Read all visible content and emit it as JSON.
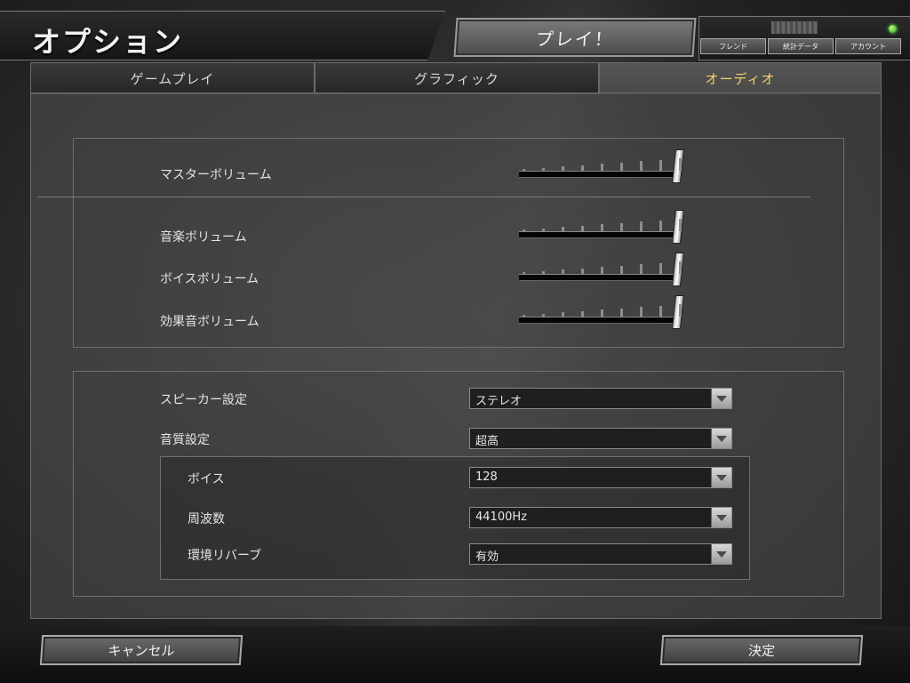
{
  "header": {
    "title": "オプション",
    "play_label": "プレイ！",
    "buttons": [
      "フレンド",
      "統計データ",
      "アカウント"
    ]
  },
  "tabs": [
    {
      "label": "ゲームプレイ",
      "active": false
    },
    {
      "label": "グラフィック",
      "active": false
    },
    {
      "label": "オーディオ",
      "active": true
    }
  ],
  "volume": {
    "master_label": "マスターボリューム",
    "music_label": "音楽ボリューム",
    "voice_label": "ボイスボリューム",
    "effects_label": "効果音ボリューム",
    "master_level": 1.0,
    "music_level": 1.0,
    "voice_level": 1.0,
    "effects_level": 1.0
  },
  "settings": {
    "speaker_label": "スピーカー設定",
    "speaker_value": "ステレオ",
    "quality_label": "音質設定",
    "quality_value": "超高",
    "voices_label": "ボイス",
    "voices_value": "128",
    "frequency_label": "周波数",
    "frequency_value": "44100Hz",
    "reverb_label": "環境リバーブ",
    "reverb_value": "有効"
  },
  "footer": {
    "cancel_label": "キャンセル",
    "ok_label": "決定"
  },
  "colors": {
    "active_tab_text": "#f5d36a",
    "status_online": "#2e9a1c"
  }
}
